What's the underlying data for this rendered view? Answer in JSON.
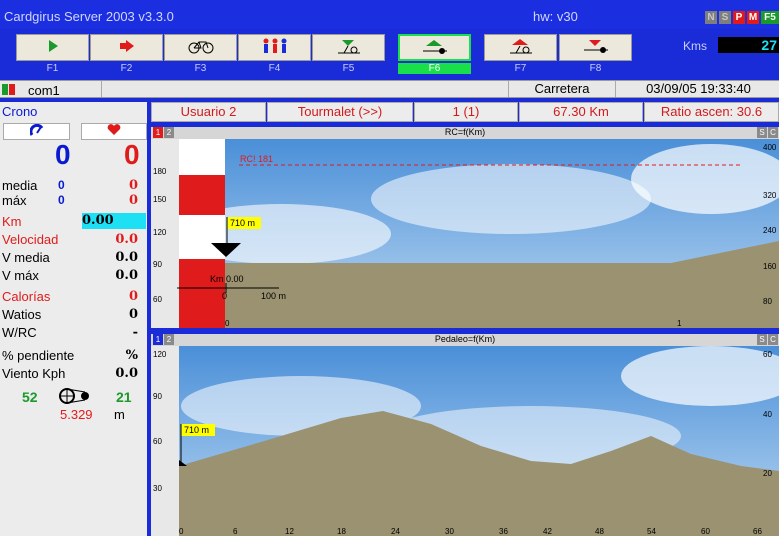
{
  "app": {
    "title": "Cardgirus Server 2003 v3.3.0",
    "hw": "hw: v30",
    "flags": [
      "N",
      "S",
      "P",
      "M",
      "F5"
    ]
  },
  "kms": {
    "label": "Kms",
    "value": "27"
  },
  "toolbar": {
    "keys": [
      "F1",
      "F2",
      "F3",
      "F4",
      "F5",
      "F6",
      "F7",
      "F8"
    ],
    "active": "F6",
    "icons": [
      "play-icon",
      "exit-icon",
      "bicycle-icon",
      "riders-icon",
      "descend-icon",
      "flat-icon",
      "climb-icon",
      "brake-icon"
    ]
  },
  "statusbar": {
    "port": "com1",
    "terrain": "Carretera",
    "datetime": "03/09/05 19:33:40"
  },
  "left": {
    "crono": "Crono",
    "speed_big": "0",
    "hr_big": "0",
    "media_label": "media",
    "media_a": "0",
    "media_b": "0",
    "max_label": "máx",
    "max_a": "0",
    "max_b": "0",
    "km_label": "Km",
    "km_value": "0.00",
    "vel_label": "Velocidad",
    "vel_value": "0.0",
    "vmedia_label": "V media",
    "vmedia_value": "0.0",
    "vmax_label": "V máx",
    "vmax_value": "0.0",
    "cal_label": "Calorías",
    "cal_value": "0",
    "watts_label": "Watios",
    "watts_value": "0",
    "wrc_label": "W/RC",
    "wrc_value": "-",
    "pend_label": "% pendiente",
    "pend_value": "%",
    "wind_label": "Viento Kph",
    "wind_value": "0.0",
    "gear_front": "52",
    "gear_rear": "21",
    "dev_value": "5.329",
    "dev_unit": "m"
  },
  "info": {
    "user": "Usuario 2",
    "route": "Tourmalet (>>)",
    "lap": "1 (1)",
    "distance": "67.30 Km",
    "ratio": "Ratio ascen: 30.6"
  },
  "chart1": {
    "title": "RC=f(Km)",
    "tabs": [
      "1",
      "2"
    ],
    "rc_line": "RC! 181",
    "altitude_flag": "710 m",
    "km_marker": "Km 0.00",
    "scale_zero": "0",
    "scale_label": "100 m",
    "left_ticks": [
      "180",
      "150",
      "120",
      "90",
      "60"
    ],
    "right_ticks": [
      "400",
      "320",
      "240",
      "160",
      "80"
    ],
    "x_ticks": [
      "0",
      "1"
    ],
    "corner": [
      "S",
      "C"
    ]
  },
  "chart2": {
    "title": "Pedaleo=f(Km)",
    "tabs": [
      "1",
      "2"
    ],
    "altitude_flag": "710 m",
    "left_ticks": [
      "120",
      "90",
      "60",
      "30"
    ],
    "right_ticks": [
      "60",
      "40",
      "20"
    ],
    "x_ticks": [
      "0",
      "6",
      "12",
      "18",
      "24",
      "30",
      "36",
      "42",
      "48",
      "54",
      "60",
      "66"
    ],
    "corner": [
      "S",
      "C"
    ]
  },
  "colors": {
    "title_bg": "#1c2fe0",
    "accent_red": "#d21a1a",
    "accent_blue": "#0a1ad0",
    "active_green": "#19e04a",
    "terrain": "#9a9270",
    "km_highlight": "#1ee0f5"
  }
}
